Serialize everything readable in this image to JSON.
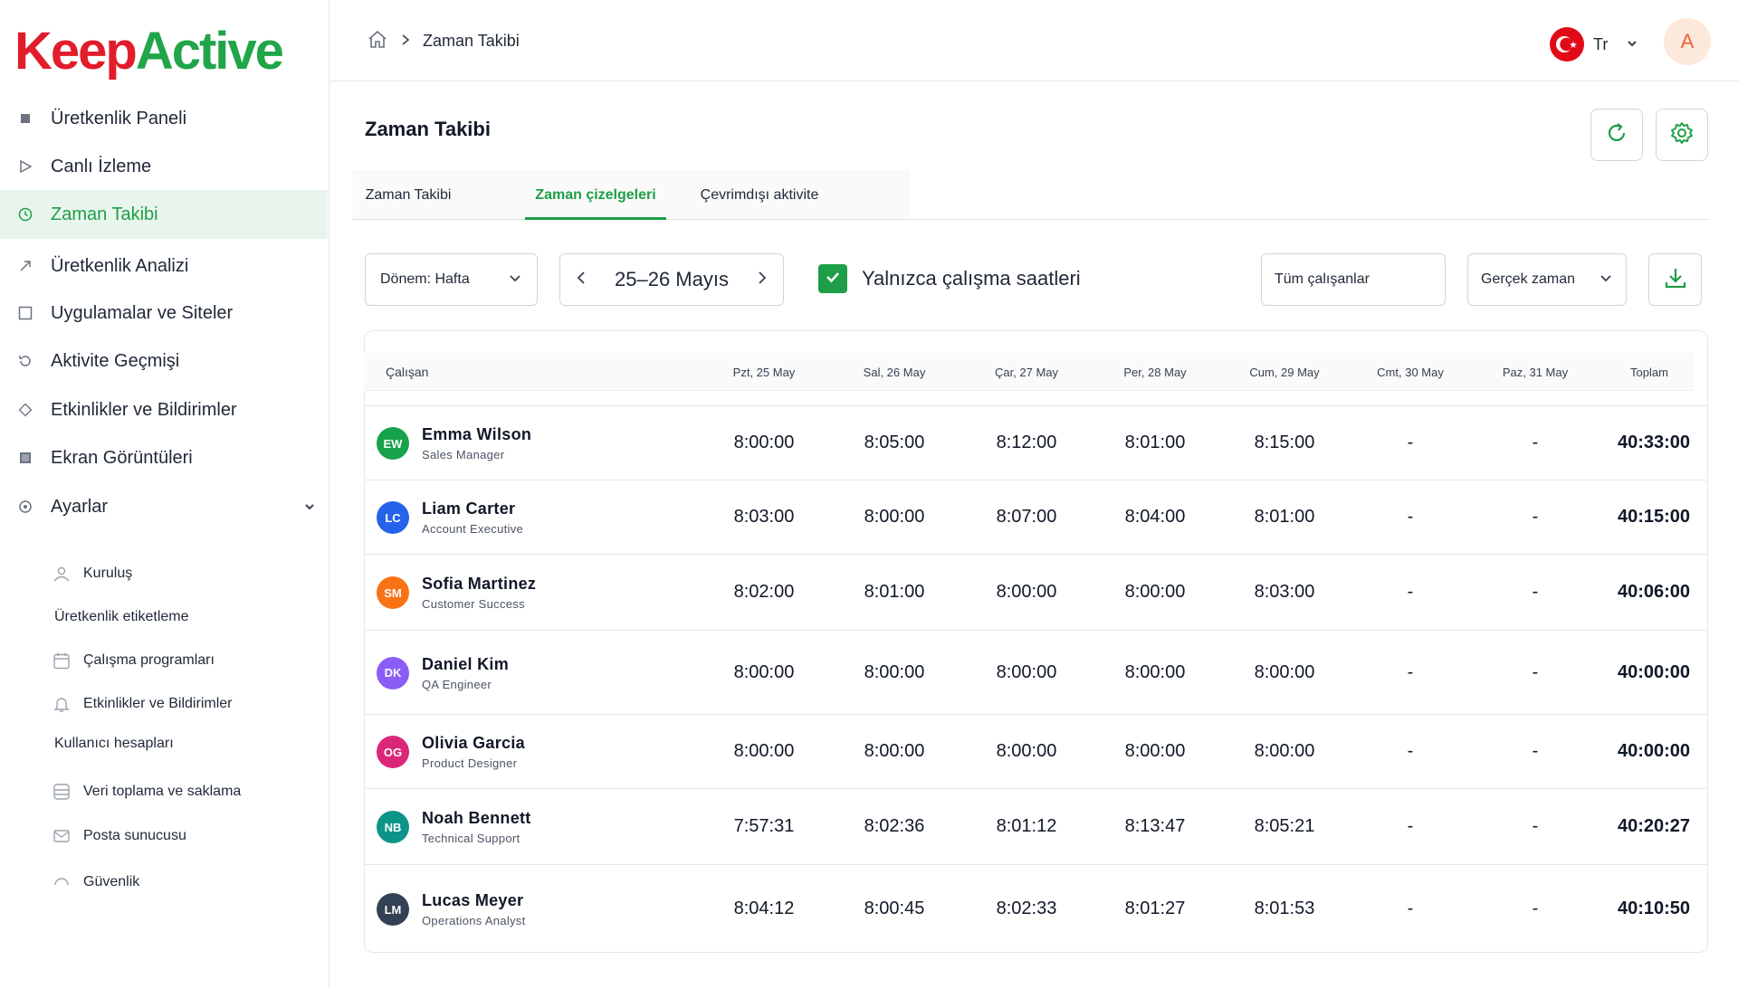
{
  "brand": {
    "part1": "Keep",
    "part2": "Active"
  },
  "sidebar": {
    "items": [
      {
        "label": "Üretkenlik Paneli",
        "icon": "square-icon"
      },
      {
        "label": "Canlı İzleme",
        "icon": "play-icon"
      },
      {
        "label": "Zaman Takibi",
        "icon": "clock-icon",
        "active": true
      },
      {
        "label": "Üretkenlik Analizi",
        "icon": "trend-arrow-icon"
      },
      {
        "label": "Uygulamalar ve Siteler",
        "icon": "window-icon"
      },
      {
        "label": "Aktivite Geçmişi",
        "icon": "history-icon"
      },
      {
        "label": "Etkinlikler ve Bildirimler",
        "icon": "diamond-icon"
      },
      {
        "label": "Ekran Görüntüleri",
        "icon": "screenshot-icon"
      },
      {
        "label": "Ayarlar",
        "icon": "settings-circle-icon"
      }
    ],
    "settings_sub": [
      {
        "label": "Kuruluş",
        "icon": "organization-icon"
      },
      {
        "label": "Üretkenlik etiketleme",
        "icon": ""
      },
      {
        "label": "Çalışma programları",
        "icon": "calendar-icon"
      },
      {
        "label": "Etkinlikler ve Bildirimler",
        "icon": "bell-icon"
      },
      {
        "label": "Kullanıcı hesapları",
        "icon": ""
      },
      {
        "label": "Veri toplama ve saklama",
        "icon": "database-icon"
      },
      {
        "label": "Posta sunucusu",
        "icon": "mail-icon"
      },
      {
        "label": "Güvenlik",
        "icon": "shield-icon"
      }
    ]
  },
  "topbar": {
    "breadcrumb_current": "Zaman Takibi",
    "language": "Tr",
    "avatar_initial": "A"
  },
  "main": {
    "title": "Zaman Takibi",
    "tabs": [
      {
        "label": "Zaman Takibi"
      },
      {
        "label": "Zaman çizelgeleri",
        "active": true
      },
      {
        "label": "Çevrimdışı aktivite"
      }
    ],
    "filters": {
      "period": "Dönem: Hafta",
      "date_range": "25–26 Mayıs",
      "only_work_hours_label": "Yalnızca çalışma saatleri",
      "only_work_hours_checked": true,
      "employees": "Tüm çalışanlar",
      "time_mode": "Gerçek zaman"
    }
  },
  "table": {
    "columns": [
      "Çalışan",
      "Pzt, 25 May",
      "Sal, 26 May",
      "Çar, 27 May",
      "Per, 28 May",
      "Cum, 29 May",
      "Cmt, 30 May",
      "Paz, 31 May",
      "Toplam"
    ],
    "rows": [
      {
        "initials": "EW",
        "color": "#16a34a",
        "name": "Emma Wilson",
        "role": "Sales Manager",
        "days": [
          "8:00:00",
          "8:05:00",
          "8:12:00",
          "8:01:00",
          "8:15:00",
          "-",
          "-"
        ],
        "total": "40:33:00"
      },
      {
        "initials": "LC",
        "color": "#2563eb",
        "name": "Liam Carter",
        "role": "Account Executive",
        "days": [
          "8:03:00",
          "8:00:00",
          "8:07:00",
          "8:04:00",
          "8:01:00",
          "-",
          "-"
        ],
        "total": "40:15:00"
      },
      {
        "initials": "SM",
        "color": "#f97316",
        "name": "Sofia Martinez",
        "role": "Customer Success",
        "days": [
          "8:02:00",
          "8:01:00",
          "8:00:00",
          "8:00:00",
          "8:03:00",
          "-",
          "-"
        ],
        "total": "40:06:00"
      },
      {
        "initials": "DK",
        "color": "#8b5cf6",
        "name": "Daniel Kim",
        "role": "QA Engineer",
        "days": [
          "8:00:00",
          "8:00:00",
          "8:00:00",
          "8:00:00",
          "8:00:00",
          "-",
          "-"
        ],
        "total": "40:00:00"
      },
      {
        "initials": "OG",
        "color": "#db2777",
        "name": "Olivia Garcia",
        "role": "Product Designer",
        "days": [
          "8:00:00",
          "8:00:00",
          "8:00:00",
          "8:00:00",
          "8:00:00",
          "-",
          "-"
        ],
        "total": "40:00:00"
      },
      {
        "initials": "NB",
        "color": "#0d9488",
        "name": "Noah Bennett",
        "role": "Technical Support",
        "days": [
          "7:57:31",
          "8:02:36",
          "8:01:12",
          "8:13:47",
          "8:05:21",
          "-",
          "-"
        ],
        "total": "40:20:27"
      },
      {
        "initials": "LM",
        "color": "#334155",
        "name": "Lucas Meyer",
        "role": "Operations Analyst",
        "days": [
          "8:04:12",
          "8:00:45",
          "8:02:33",
          "8:01:27",
          "8:01:53",
          "-",
          "-"
        ],
        "total": "40:10:50"
      }
    ]
  }
}
